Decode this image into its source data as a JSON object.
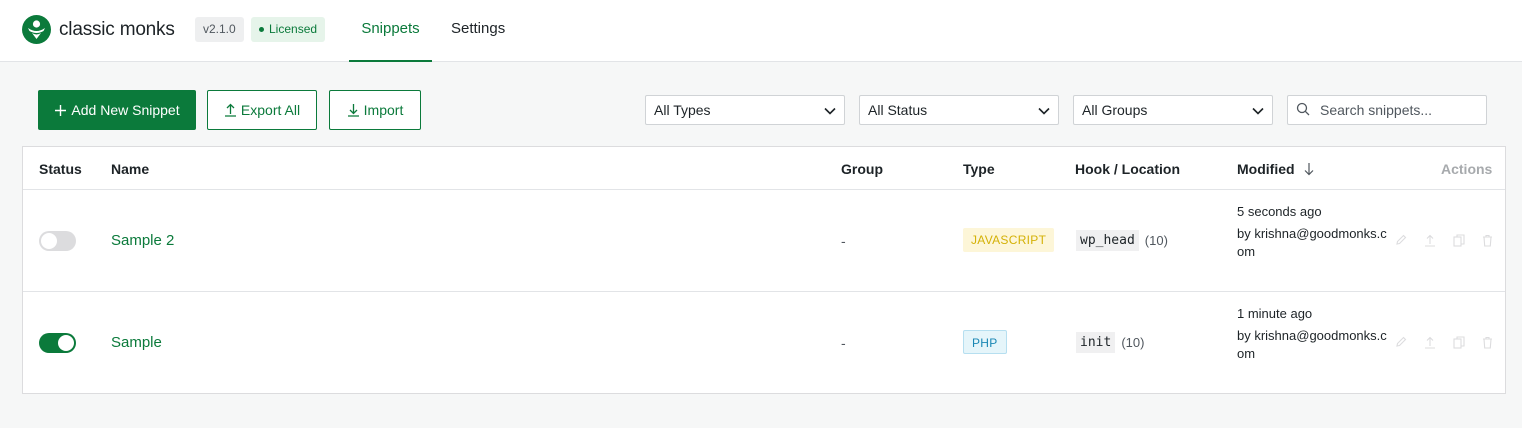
{
  "header": {
    "brand": "classic monks",
    "version": "v2.1.0",
    "license": "Licensed",
    "tabs": [
      {
        "label": "Snippets",
        "active": true
      },
      {
        "label": "Settings",
        "active": false
      }
    ]
  },
  "toolbar": {
    "add_label": "Add New Snippet",
    "export_label": "Export All",
    "import_label": "Import",
    "filters": {
      "types": "All Types",
      "status": "All Status",
      "groups": "All Groups"
    },
    "search_placeholder": "Search snippets..."
  },
  "table": {
    "columns": {
      "status": "Status",
      "name": "Name",
      "group": "Group",
      "type": "Type",
      "hook": "Hook / Location",
      "modified": "Modified",
      "actions": "Actions"
    },
    "rows": [
      {
        "enabled": false,
        "name": "Sample 2",
        "group": "-",
        "type": "JAVASCRIPT",
        "hook": "wp_head",
        "priority": "(10)",
        "modified": "5 seconds ago",
        "by": "by krishna@goodmonks.com"
      },
      {
        "enabled": true,
        "name": "Sample",
        "group": "-",
        "type": "PHP",
        "hook": "init",
        "priority": "(10)",
        "modified": "1 minute ago",
        "by": "by krishna@goodmonks.com"
      }
    ]
  },
  "colors": {
    "accent": "#0b7a3b",
    "js_badge": "#d4b106",
    "php_badge": "#1a87b4"
  }
}
